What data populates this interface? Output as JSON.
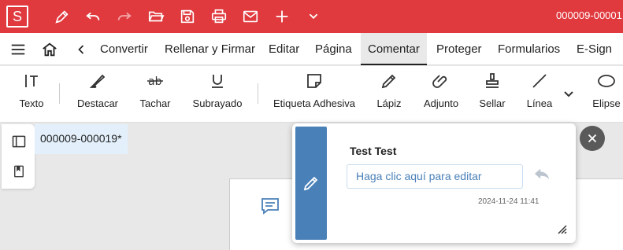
{
  "app": {
    "logo_letter": "S",
    "document_title": "000009-00001"
  },
  "toolbar_icons": [
    "pen-icon",
    "undo-icon",
    "redo-icon",
    "open-folder-icon",
    "save-icon",
    "print-icon",
    "mail-icon",
    "plus-icon",
    "chevron-down-icon"
  ],
  "menu": {
    "items": [
      "Convertir",
      "Rellenar y Firmar",
      "Editar",
      "Página",
      "Comentar",
      "Proteger",
      "Formularios",
      "E-Sign"
    ],
    "active": "Comentar"
  },
  "ribbon": {
    "tools": [
      {
        "label": "Texto",
        "icon": "text-tool-icon"
      },
      {
        "label": "Destacar",
        "icon": "highlight-icon"
      },
      {
        "label": "Tachar",
        "icon": "strikethrough-icon"
      },
      {
        "label": "Subrayado",
        "icon": "underline-icon"
      },
      {
        "label": "Etiqueta Adhesiva",
        "icon": "sticky-note-icon"
      },
      {
        "label": "Lápiz",
        "icon": "pencil-icon"
      },
      {
        "label": "Adjunto",
        "icon": "paperclip-icon"
      },
      {
        "label": "Sellar",
        "icon": "stamp-icon"
      },
      {
        "label": "Línea",
        "icon": "line-icon"
      },
      {
        "label": "Elipse",
        "icon": "ellipse-icon"
      }
    ]
  },
  "tabs": [
    {
      "label": "000009-000019*"
    }
  ],
  "comment": {
    "author": "Test Test",
    "placeholder": "Haga clic aquí para editar",
    "timestamp": "2024-11-24 11:41"
  },
  "colors": {
    "brand": "#e0393e",
    "accent": "#4a80b8"
  }
}
